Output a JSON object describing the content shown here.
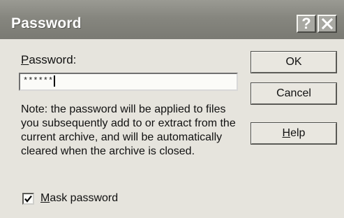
{
  "window": {
    "title": "Password",
    "help_button": "?",
    "close_icon": "close-icon"
  },
  "password": {
    "label": "Password:",
    "label_mnemonic": "P",
    "label_rest": "assword:",
    "value": "******"
  },
  "note": "Note:  the password will be applied to files you subsequently add to or extract from the current archive, and will be automatically cleared when the archive is closed.",
  "buttons": {
    "ok": "OK",
    "cancel": "Cancel",
    "help": "Help",
    "help_mnemonic": "H",
    "help_rest": "elp"
  },
  "mask_password": {
    "label": "Mask password",
    "label_mnemonic": "M",
    "label_rest": "ask password",
    "checked": true
  },
  "colors": {
    "titlebar": "#86867f",
    "dialog_bg": "#e6e4dd"
  }
}
